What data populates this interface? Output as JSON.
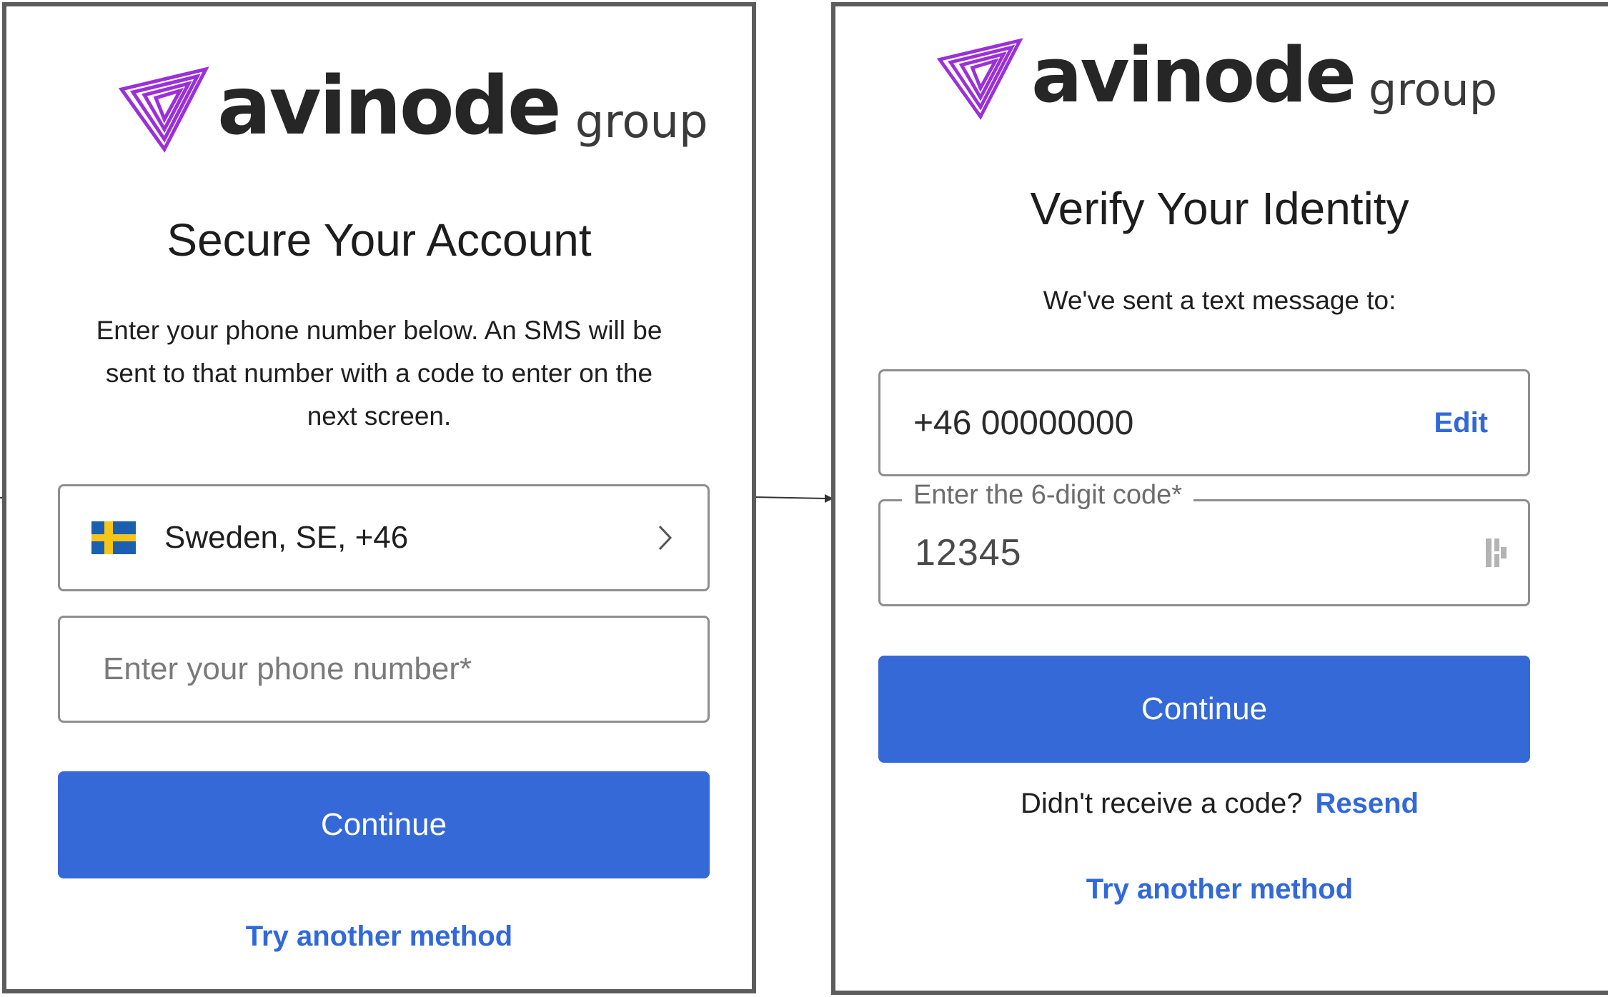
{
  "brand": {
    "wordmark": "avinode",
    "suffix": "group",
    "accent_color": "#9b30d9"
  },
  "secure_screen": {
    "title": "Secure Your Account",
    "description_lines": [
      "Enter your phone number below. An SMS will be",
      "sent to that number with a code to enter on the",
      "next screen."
    ],
    "country_select": {
      "flag_icon": "sweden-flag-icon",
      "value": "Sweden, SE, +46",
      "chevron_icon": "chevron-right-icon"
    },
    "phone_input": {
      "placeholder": "Enter your phone number*",
      "value": ""
    },
    "continue_label": "Continue",
    "alt_method_label": "Try another method"
  },
  "verify_screen": {
    "title": "Verify Your Identity",
    "sent_message": "We've sent a text message to:",
    "phone": {
      "value": "+46 00000000",
      "edit_label": "Edit"
    },
    "code_field": {
      "label": "Enter the 6-digit code*",
      "value": "12345",
      "icon": "password-manager-key-icon"
    },
    "continue_label": "Continue",
    "resend_prompt": "Didn't receive a code?",
    "resend_label": "Resend",
    "alt_method_label": "Try another method"
  },
  "colors": {
    "primary": "#3669d8",
    "link": "#3269d8",
    "border": "#8e8e8e",
    "panel_border": "#5c5c5c"
  }
}
